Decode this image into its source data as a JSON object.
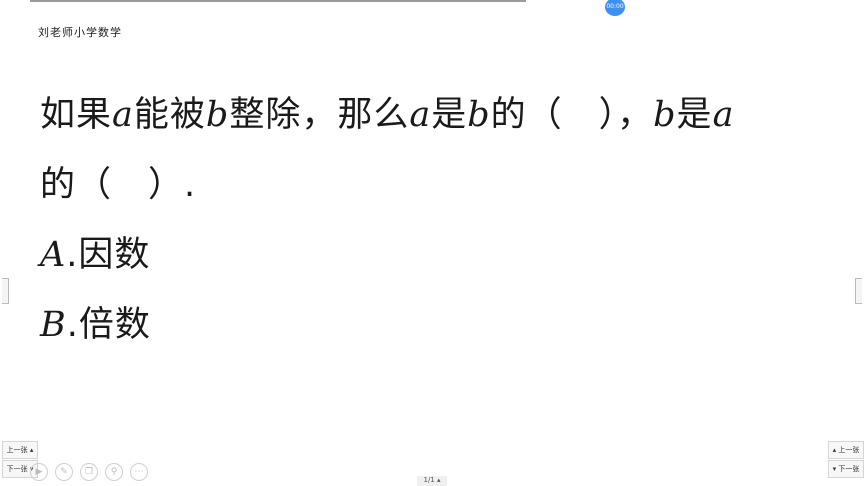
{
  "header": {
    "timer": "00:00",
    "channel_title": "刘老师小学数学"
  },
  "question": {
    "line1_a": "如果",
    "var_a": "a",
    "line1_b": "能被",
    "var_b": "b",
    "line1_c": "整除，那么",
    "line1_d": "是",
    "line1_e": "的（　），",
    "line1_f": "是",
    "line2": "的（　）."
  },
  "options": [
    {
      "letter": "A",
      "text": "因数"
    },
    {
      "letter": "B",
      "text": "倍数"
    }
  ],
  "nav": {
    "prev_label": "上一张",
    "next_label": "下一张"
  },
  "toolbar": {
    "page_indicator": "1/1"
  }
}
